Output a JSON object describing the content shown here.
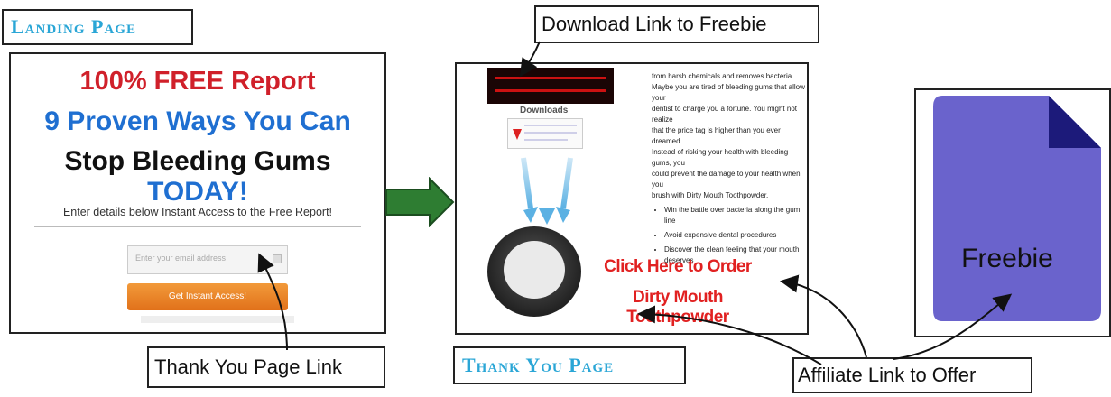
{
  "landing_title": "Landing Page",
  "thank_you_title": "Thank You Page",
  "landing_page": {
    "line1": "100% FREE Report",
    "line2": "9 Proven Ways You Can",
    "line3_main": "Stop Bleeding Gums",
    "line3_accent": "TODAY!",
    "enter_text": "Enter details below Instant Access to the Free Report!",
    "email_placeholder": "Enter your email address",
    "button_label": "Get Instant Access!"
  },
  "thank_you_page": {
    "downloads_label": "Downloads",
    "body_lines": [
      "from harsh chemicals and removes bacteria.",
      "Maybe you are tired of bleeding gums that allow your",
      "dentist to charge you a fortune. You might not realize",
      "that the price tag is higher than you ever dreamed.",
      "Instead of risking your health with bleeding gums, you",
      "could prevent the damage to your health when you",
      "brush with Dirty Mouth Toothpowder."
    ],
    "bullets": [
      "Win the battle over bacteria along the gum line",
      "Avoid expensive dental procedures",
      "Discover the clean feeling that your mouth deserves"
    ],
    "cta_line1": "Click Here to Order",
    "cta_line2": "Dirty Mouth Toothpowder"
  },
  "freebie_label": "Freebie",
  "callouts": {
    "download_link": "Download Link to Freebie",
    "thank_you_link": "Thank You Page Link",
    "affiliate_link": "Affiliate Link to Offer"
  },
  "colors": {
    "title_blue": "#2aa6d6",
    "arrow_green": "#2e7d32",
    "freebie_purple": "#6a63cc",
    "cta_red": "#e12121"
  }
}
